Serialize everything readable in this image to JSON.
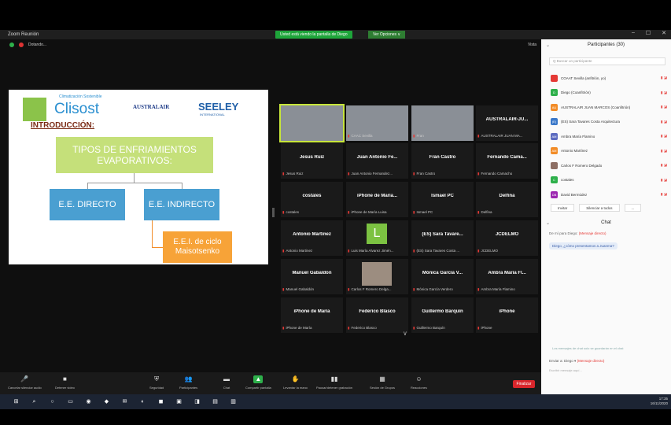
{
  "titlebar": {
    "app_title": "Zoom Reunión",
    "share_banner": "Usted está viendo la pantalla de Diego",
    "view_options": "Ver Opciones ∨",
    "controls": [
      "–",
      "☐",
      "✕"
    ]
  },
  "meeting_top": {
    "owner": "Dotando...",
    "view_label": "Vista"
  },
  "slide": {
    "clisost_tag": "Climatización Sostenible",
    "clisost": "Clisost",
    "australair": "AUSTRALAIR",
    "seeley": "SEELEY",
    "seeley_sub": "INTERNATIONAL",
    "heading": "INTRODUCCIÓN:",
    "box_main": "TIPOS DE ENFRIAMIENTOS EVAPORATIVOS:",
    "box_direct": "E.E. DIRECTO",
    "box_indirect": "E.E. INDIRECTO",
    "box_ciclo": "E.E.I. de ciclo Maisotsenko"
  },
  "grid": {
    "tiles": [
      {
        "name": "",
        "label": "",
        "kind": "video"
      },
      {
        "name": "",
        "label": "CAAC Sevilla",
        "kind": "video"
      },
      {
        "name": "",
        "label": "Fran",
        "kind": "video"
      },
      {
        "name": "AUSTRALAIR-JU...",
        "label": "AUSTRALAIR JUAN MA...",
        "kind": "name"
      },
      {
        "name": "Jesus Ruiz",
        "label": "Jesus Ruiz",
        "kind": "name"
      },
      {
        "name": "Juan Antonio Fe...",
        "label": "Juan Antonio Fernandez...",
        "kind": "name"
      },
      {
        "name": "Fran Castro",
        "label": "Fran Castro",
        "kind": "name"
      },
      {
        "name": "Fernando Cama...",
        "label": "Fernando Camacho",
        "kind": "name"
      },
      {
        "name": "costales",
        "label": "costales",
        "kind": "name"
      },
      {
        "name": "iPhone de María...",
        "label": "iPhone de María Luisa",
        "kind": "name"
      },
      {
        "name": "Ismael PC",
        "label": "Ismael PC",
        "kind": "name"
      },
      {
        "name": "Delfina",
        "label": "Delfina",
        "kind": "name"
      },
      {
        "name": "Antonio Martínez",
        "label": "Antonio Martinez",
        "kind": "name"
      },
      {
        "name": "L",
        "label": "Luis María Alvarez Jimén...",
        "kind": "avatar"
      },
      {
        "name": "(ES) Sara Tavare...",
        "label": "(ES) Sara Tavares Costa ...",
        "kind": "name"
      },
      {
        "name": "JCDELMO",
        "label": "JCDELMO",
        "kind": "name"
      },
      {
        "name": "Manuel Gabaldón",
        "label": "Manuel Gabaldón",
        "kind": "name"
      },
      {
        "name": "",
        "label": "Carlos F Romero Delga...",
        "kind": "photo"
      },
      {
        "name": "Mónica García V...",
        "label": "Mónica García Verdero",
        "kind": "name"
      },
      {
        "name": "Ambra María Fl...",
        "label": "Ambra María Flamino",
        "kind": "name"
      },
      {
        "name": "iPhone de María",
        "label": "iPhone de María",
        "kind": "name"
      },
      {
        "name": "Federico Blasco",
        "label": "Federico Blasco",
        "kind": "name"
      },
      {
        "name": "Guillermo Barquín",
        "label": "Guillermo Barquín",
        "kind": "name"
      },
      {
        "name": "iPhone",
        "label": "iPhone",
        "kind": "name"
      }
    ]
  },
  "toolbar": {
    "items": [
      {
        "label": "Cancelar silenciar audio",
        "icon": "🎤"
      },
      {
        "label": "Detener video",
        "icon": "■"
      },
      {
        "label": "Seguridad",
        "icon": "⛨"
      },
      {
        "label": "Participantes",
        "icon": "👥"
      },
      {
        "label": "Chat",
        "icon": "▬"
      },
      {
        "label": "Compartir pantalla",
        "icon": "▲"
      },
      {
        "label": "Levantar la mano",
        "icon": "✋"
      },
      {
        "label": "Pausar/detener grabación",
        "icon": "▮▮"
      },
      {
        "label": "Sesión de Grupos",
        "icon": "▦"
      },
      {
        "label": "Reacciones",
        "icon": "☺"
      }
    ],
    "end_label": "Finalizar"
  },
  "panel": {
    "title": "Participantes (30)",
    "search_placeholder": "Q Buscar un participante",
    "participants": [
      {
        "initials": "",
        "name": "COAAT Sevilla (anfitrión, yo)",
        "color": "#e53935"
      },
      {
        "initials": "D",
        "name": "Diego (Coanfitrión)",
        "color": "#2eb04b"
      },
      {
        "initials": "AU",
        "name": "AUSTRALAIR JUAN MARCOS (Coanfitrión)",
        "color": "#f28c28"
      },
      {
        "initials": "(E)",
        "name": "(ES) Sara Tavares Costa Arquitectura",
        "color": "#3a78c9"
      },
      {
        "initials": "AM",
        "name": "Ambra María Flamino",
        "color": "#5c6bc0"
      },
      {
        "initials": "AM",
        "name": "Antonio Martínez",
        "color": "#f28c28"
      },
      {
        "initials": "",
        "name": "Carlos F Romero Delgado",
        "color": "#8d6e63"
      },
      {
        "initials": "C",
        "name": "costales",
        "color": "#2eb04b"
      },
      {
        "initials": "DB",
        "name": "David Bermúdez",
        "color": "#9c27b0"
      }
    ],
    "invite_label": "Invitar",
    "mute_all_label": "Silenciar a todos",
    "more_label": "...",
    "chat_title": "Chat",
    "chat_from": "De mí para Diego:",
    "chat_to": "(Mensaje directo)",
    "chat_message": "Diego, ¿cómo presentamos a Juanma?",
    "chat_hint": "Los mensajes de chat solo se guardarán en el chat",
    "send_to_label": "Enviar a:",
    "send_to_value": "Diego ▾",
    "send_to_direct": "(Mensaje directo)",
    "input_hint": "Escribir mensaje aquí..."
  },
  "taskbar": {
    "icons": [
      "⊞",
      "⌕",
      "○",
      "▭",
      "◉",
      "◆",
      "✉",
      "◐",
      "◼",
      "▣",
      "◨",
      "▤",
      "▥"
    ],
    "time": "17:35",
    "date": "16/11/2020"
  }
}
